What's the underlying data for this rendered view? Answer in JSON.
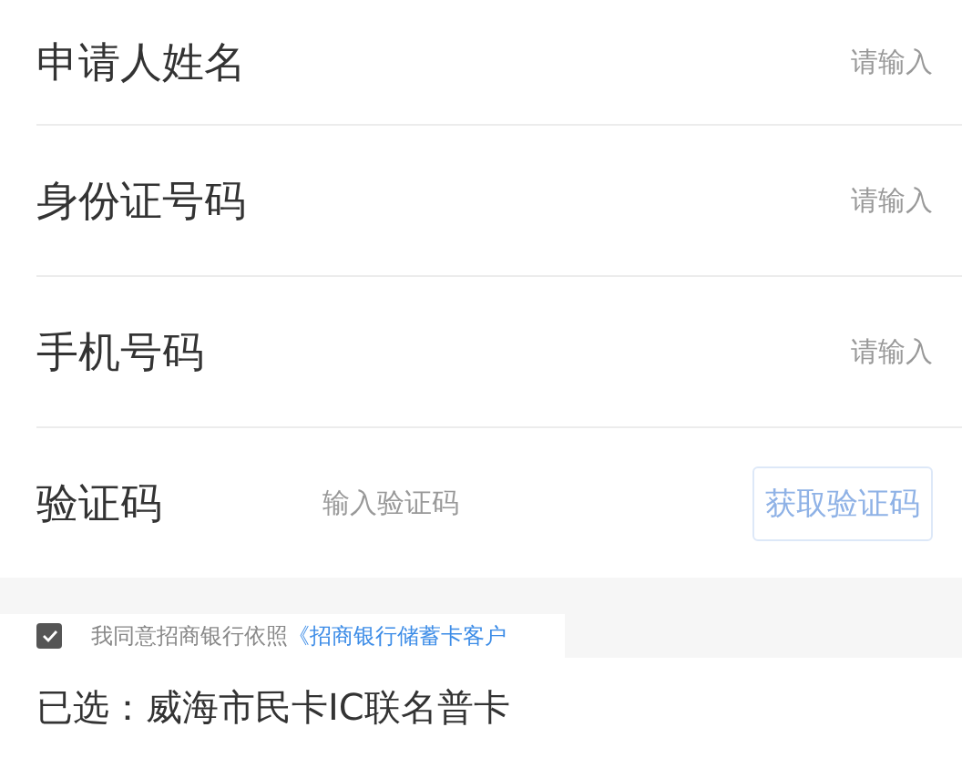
{
  "fields": [
    {
      "label": "申请人姓名",
      "placeholder": "请输入"
    },
    {
      "label": "身份证号码",
      "placeholder": "请输入"
    },
    {
      "label": "手机号码",
      "placeholder": "请输入"
    }
  ],
  "verification": {
    "label": "验证码",
    "placeholder": "输入验证码",
    "button": {
      "label": "获取验证码",
      "disabled": true
    }
  },
  "agreement": {
    "checked": true,
    "text": "我同意招商银行依照",
    "link": "《招商银行储蓄卡客户"
  },
  "selected_card": "已选：威海市民卡IC联名普卡"
}
